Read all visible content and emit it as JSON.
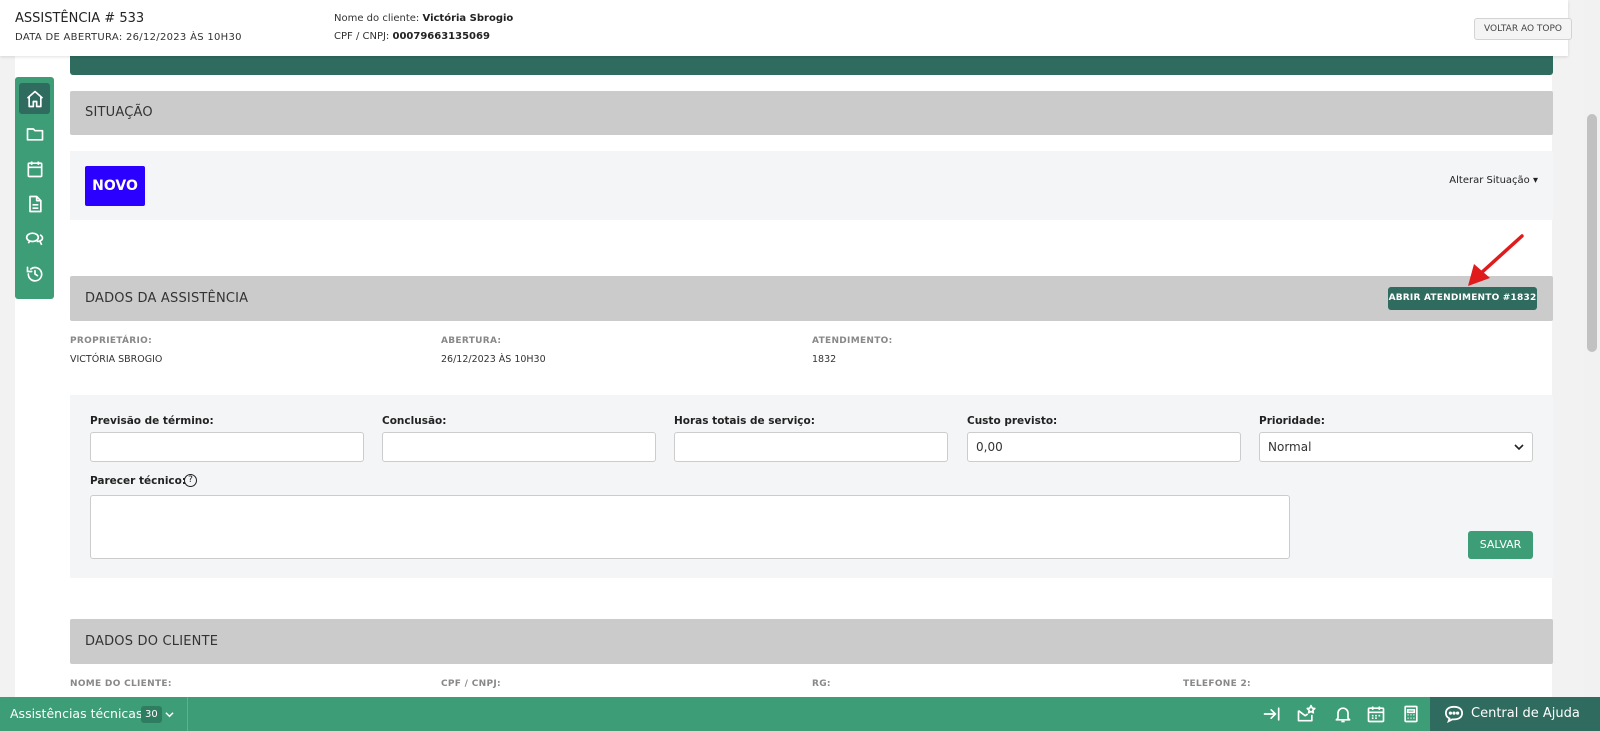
{
  "header": {
    "title": "ASSISTÊNCIA # 533",
    "opening": "DATA DE ABERTURA: 26/12/2023 ÀS 10H30",
    "client_label": "Nome do cliente:",
    "client_name": "Victória Sbrogio",
    "cpf_label": "CPF / CNPJ:",
    "cpf_value": "00079663135069",
    "back_to_top": "VOLTAR AO TOPO"
  },
  "sidebar": {
    "items": [
      {
        "icon": "home-icon",
        "active": true
      },
      {
        "icon": "folder-icon"
      },
      {
        "icon": "calendar-icon"
      },
      {
        "icon": "document-icon"
      },
      {
        "icon": "chat-icon"
      },
      {
        "icon": "history-icon"
      }
    ]
  },
  "situacao": {
    "title": "SITUAÇÃO",
    "badge": "NOVO",
    "badge_color": "#2b00ff",
    "change_label": "Alterar Situação"
  },
  "dados_assistencia": {
    "title": "DADOS DA ASSISTÊNCIA",
    "open_button": "ABRIR ATENDIMENTO #1832",
    "fields": [
      {
        "label": "PROPRIETÁRIO:",
        "value": "VICTÓRIA SBROGIO"
      },
      {
        "label": "ABERTURA:",
        "value": "26/12/2023 ÀS 10H30"
      },
      {
        "label": "ATENDIMENTO:",
        "value": "1832"
      }
    ]
  },
  "form": {
    "previsao_label": "Previsão de término:",
    "previsao_value": "",
    "conclusao_label": "Conclusão:",
    "conclusao_value": "",
    "horas_label": "Horas totais de serviço:",
    "horas_value": "",
    "custo_label": "Custo previsto:",
    "custo_value": "0,00",
    "prioridade_label": "Prioridade:",
    "prioridade_value": "Normal",
    "parecer_label": "Parecer técnico:",
    "help": "?",
    "save_button": "SALVAR"
  },
  "dados_cliente": {
    "title": "DADOS DO CLIENTE",
    "fields": [
      "NOME DO CLIENTE:",
      "CPF / CNPJ:",
      "RG:",
      "TELEFONE 2:"
    ]
  },
  "bottom_bar": {
    "title": "Assistências técnicas",
    "count": "30",
    "help_label": "Central de Ajuda"
  },
  "colors": {
    "primary": "#3d9d77",
    "dark": "#2f6b5e",
    "annotation_arrow": "#e01b1b"
  }
}
